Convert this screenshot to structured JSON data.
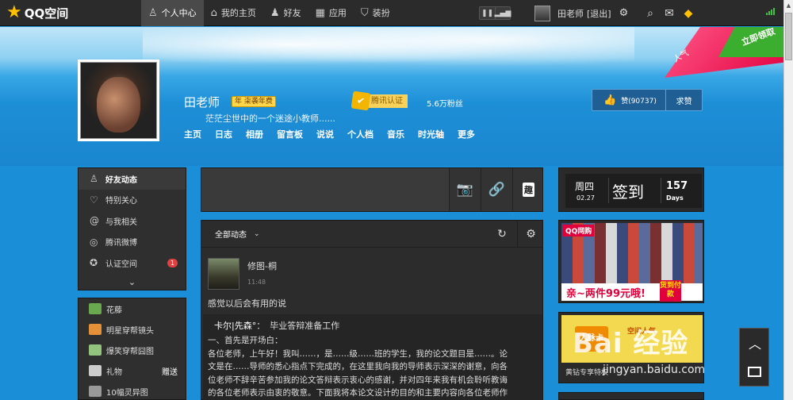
{
  "topbar": {
    "logo_text": "QQ空间",
    "nav": [
      {
        "label": "个人中心",
        "icon": "person-icon",
        "active": true
      },
      {
        "label": "我的主页",
        "icon": "home-icon",
        "active": false
      },
      {
        "label": "好友",
        "icon": "friends-icon",
        "active": false
      },
      {
        "label": "应用",
        "icon": "grid-icon",
        "active": false
      },
      {
        "label": "装扮",
        "icon": "shirt-icon",
        "active": false
      }
    ],
    "user_name": "田老师",
    "logout": "[退出]"
  },
  "banner": {
    "ribbon_text": "立即领取",
    "ribbon_small": "人气"
  },
  "profile": {
    "name": "田老师",
    "vip_text": "年 㭍袭年费",
    "verify_text": "腾讯认证",
    "fans": "5.6万粉丝",
    "motto": "茫茫尘世中的一个迷途小教师......",
    "nav": [
      "主页",
      "日志",
      "相册",
      "留言板",
      "说说",
      "个人档",
      "音乐",
      "时光轴",
      "更多"
    ],
    "like_text": "赞(90737)",
    "ask_like": "求赞"
  },
  "left_menu": {
    "items": [
      {
        "label": "好友动态",
        "icon": "friends-feed-icon"
      },
      {
        "label": "特别关心",
        "icon": "heart-icon"
      },
      {
        "label": "与我相关",
        "icon": "at-icon"
      },
      {
        "label": "腾讯微博",
        "icon": "weibo-icon"
      },
      {
        "label": "认证空间",
        "icon": "verified-space-icon",
        "badge": "1"
      }
    ],
    "apps": [
      {
        "label": "花藤",
        "color": "#6aa84f"
      },
      {
        "label": "明星穿帮镜头",
        "color": "#e69138"
      },
      {
        "label": "爆笑穿帮囧图",
        "color": "#93c47d"
      },
      {
        "label": "礼物",
        "color": "#cccccc",
        "extra": "赠送"
      },
      {
        "label": "10幅灵异图",
        "color": "#999999"
      }
    ]
  },
  "feed": {
    "filter": "全部动态",
    "post": {
      "author": "修图-桐",
      "time": "11:48",
      "text": "感觉以后会有用的说",
      "repost_name": "卡尔|先森°",
      "repost_sep": "：",
      "repost_title": "毕业答辩准备工作",
      "repost_lines": [
        "一、首先是开场白：",
        "各位老师，上午好！我叫……，是……级……班的学生，我的论文题目是……。论",
        "文是在……导师的悉心指点下完成的，在这里我向我的导师表示深深的谢意，向各",
        "位老师不辞辛苦参加我的论文答辩表示衷心的感谢，并对四年来我有机会聆听教诲",
        "的各位老师表示由衷的敬意。下面我将本论文设计的目的和主要内容向各位老师作"
      ]
    }
  },
  "checkin": {
    "weekday": "周四",
    "date": "02.27",
    "label": "签到",
    "count": "157",
    "unit": "Days"
  },
  "ads": {
    "ad1_tag": "QQ网购",
    "ad1_text": "亲~两件99元哦!",
    "ad1_pay": "货到付款",
    "ad2_card": "人脉卡",
    "ad2_title": "空间人气",
    "ad2_caption": "黄钻专享特权"
  },
  "watermark": {
    "brand": "Bai 经验",
    "url": "jingyan.baidu.com"
  }
}
